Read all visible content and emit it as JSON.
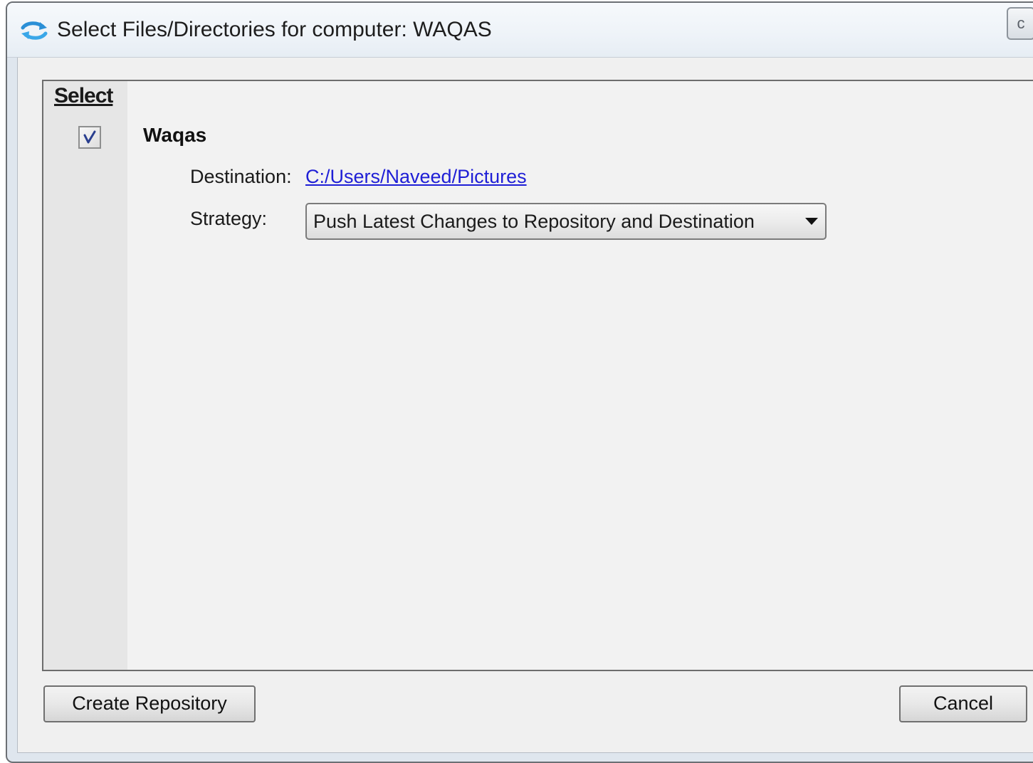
{
  "window": {
    "title": "Select Files/Directories for computer: WAQAS",
    "title_icon": "sync-arrows-icon",
    "close_icon": "close-icon",
    "close_glyph": "c"
  },
  "table": {
    "select_header": "Select",
    "item": {
      "checked": true,
      "name": "Waqas",
      "destination_label": "Destination:",
      "destination_value": "C:/Users/Naveed/Pictures",
      "strategy_label": "Strategy:",
      "strategy_value": "Push Latest Changes to Repository and Destination"
    }
  },
  "buttons": {
    "create": "Create Repository",
    "cancel": "Cancel"
  },
  "colors": {
    "link": "#1f1fd6",
    "panel_bg": "#f2f2f2",
    "select_column_bg": "#e6e6e6"
  }
}
